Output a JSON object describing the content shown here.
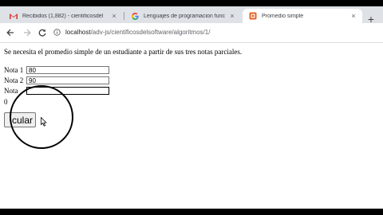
{
  "browser": {
    "tabs": [
      {
        "title": "Recibidos (1,882) - cientificosdel",
        "icon": "gmail-icon",
        "active": false
      },
      {
        "title": "Lenguajes de programacion func",
        "icon": "google-icon",
        "active": false
      },
      {
        "title": "Promedio simple",
        "icon": "page-icon",
        "active": true
      }
    ],
    "close_glyph": "×",
    "new_tab_glyph": "+",
    "address": {
      "host": "localhost",
      "path": "/adv-js/cientificosdelsoftware/algoritmos/1/"
    }
  },
  "page": {
    "intro": "Se necesita el promedio simple de un estudiante a partir de sus tres notas parciales.",
    "fields": [
      {
        "label": "Nota 1",
        "value": "80"
      },
      {
        "label": "Nota 2",
        "value": "90"
      },
      {
        "label": "Nota",
        "value": ""
      }
    ],
    "result": "0",
    "button_label": "cular"
  },
  "colors": {
    "tab_strip": "#dee1e6",
    "active_tab": "#ffffff",
    "gmail_red": "#d93025",
    "page_icon_orange": "#e8622c"
  }
}
